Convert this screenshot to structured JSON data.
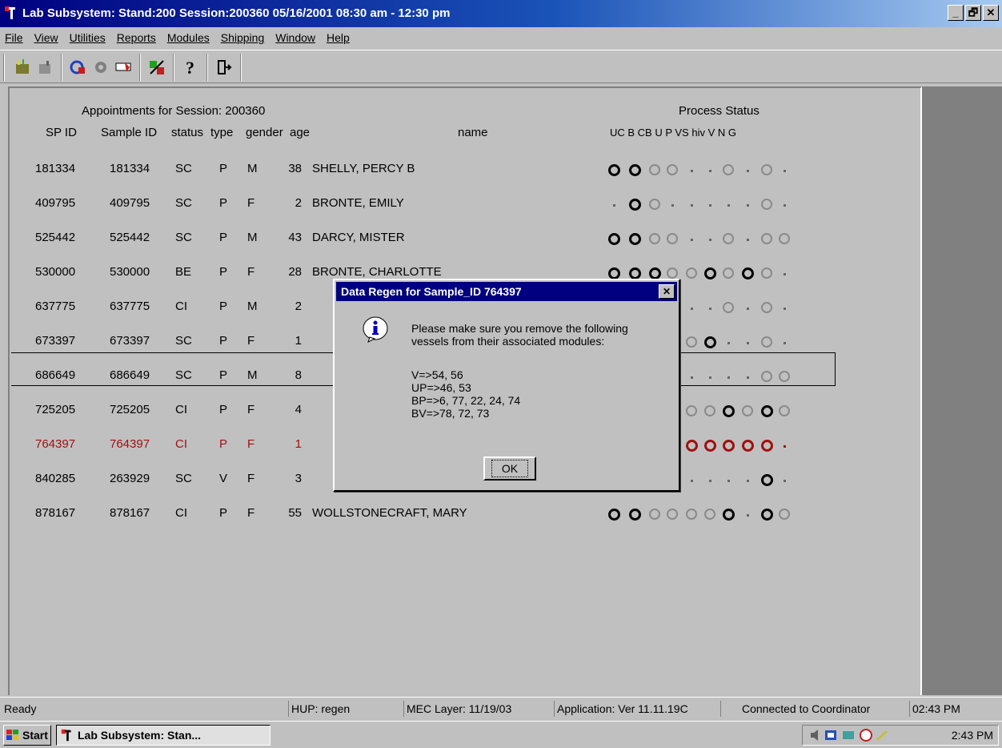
{
  "window": {
    "title": "Lab Subsystem: Stand:200 Session:200360 05/16/2001 08:30 am - 12:30 pm",
    "min": "_",
    "max": "🗗",
    "close": "✕"
  },
  "menu": [
    "File",
    "View",
    "Utilities",
    "Reports",
    "Modules",
    "Shipping",
    "Window",
    "Help"
  ],
  "toolbar": {
    "icons": [
      "new-icon",
      "save-icon",
      "lab-icon",
      "record-icon",
      "pencil-icon",
      "transfer-icon",
      "help-icon",
      "exit-icon"
    ]
  },
  "table": {
    "session_title": "Appointments for Session: 200360",
    "process_title": "Process Status",
    "headers": {
      "spid": "SP ID",
      "sampleid": "Sample ID",
      "status": "status",
      "type": "type",
      "gender": "gender",
      "age": "age",
      "name": "name",
      "process": "UC  B  CB  U   P   VS hiv  V   N   G"
    },
    "rows": [
      {
        "spid": "181334",
        "sampleid": "181334",
        "status": "SC",
        "type": "P",
        "gender": "M",
        "age": "38",
        "name": "SHELLY, PERCY B",
        "proc": "BBGG--G-G-"
      },
      {
        "spid": "409795",
        "sampleid": "409795",
        "status": "SC",
        "type": "P",
        "gender": "F",
        "age": "2",
        "name": "BRONTE, EMILY",
        "proc": "-BG-----G-"
      },
      {
        "spid": "525442",
        "sampleid": "525442",
        "status": "SC",
        "type": "P",
        "gender": "M",
        "age": "43",
        "name": "DARCY, MISTER",
        "proc": "BBGG--G-GG"
      },
      {
        "spid": "530000",
        "sampleid": "530000",
        "status": "BE",
        "type": "P",
        "gender": "F",
        "age": "28",
        "name": "BRONTE, CHARLOTTE",
        "proc": "BBBGGBGBG-"
      },
      {
        "spid": "637775",
        "sampleid": "637775",
        "status": "CI",
        "type": "P",
        "gender": "M",
        "age": "2",
        "name": "",
        "proc": "GGGG--G-G-"
      },
      {
        "spid": "673397",
        "sampleid": "673397",
        "status": "SC",
        "type": "P",
        "gender": "F",
        "age": "1",
        "name": "",
        "proc": "GGGGGB--G-"
      },
      {
        "spid": "686649",
        "sampleid": "686649",
        "status": "SC",
        "type": "P",
        "gender": "M",
        "age": "8",
        "name": "",
        "proc": "GGGG----GG"
      },
      {
        "spid": "725205",
        "sampleid": "725205",
        "status": "CI",
        "type": "P",
        "gender": "F",
        "age": "4",
        "name": "",
        "proc": "GGGGGGBGBG"
      },
      {
        "spid": "764397",
        "sampleid": "764397",
        "status": "CI",
        "type": "P",
        "gender": "F",
        "age": "1",
        "name": "",
        "proc": "RRRRRRRRR-",
        "selected": true
      },
      {
        "spid": "840285",
        "sampleid": "263929",
        "status": "SC",
        "type": "V",
        "gender": "F",
        "age": "3",
        "name": "",
        "proc": "-----.--B-"
      },
      {
        "spid": "878167",
        "sampleid": "878167",
        "status": "CI",
        "type": "P",
        "gender": "F",
        "age": "55",
        "name": "WOLLSTONECRAFT, MARY",
        "proc": "BBGGGGB-BG"
      }
    ]
  },
  "dialog": {
    "title": "Data Regen for Sample_ID 764397",
    "close": "✕",
    "icon": "info-icon",
    "line1": "Please make sure you remove the following",
    "line2": "vessels from their associated modules:",
    "v": "V=>54, 56",
    "up": "UP=>46, 53",
    "bp": "BP=>6, 77, 22, 24, 74",
    "bv": "BV=>78, 72, 73",
    "ok": "OK"
  },
  "status": {
    "ready": "Ready",
    "hup": "HUP: regen",
    "mec": "MEC Layer: 11/19/03",
    "app": "Application: Ver 11.11.19C",
    "conn": "Connected to Coordinator",
    "time": "02:43 PM"
  },
  "taskbar": {
    "start": "Start",
    "task": "Lab Subsystem: Stan...",
    "clock": "2:43 PM"
  }
}
